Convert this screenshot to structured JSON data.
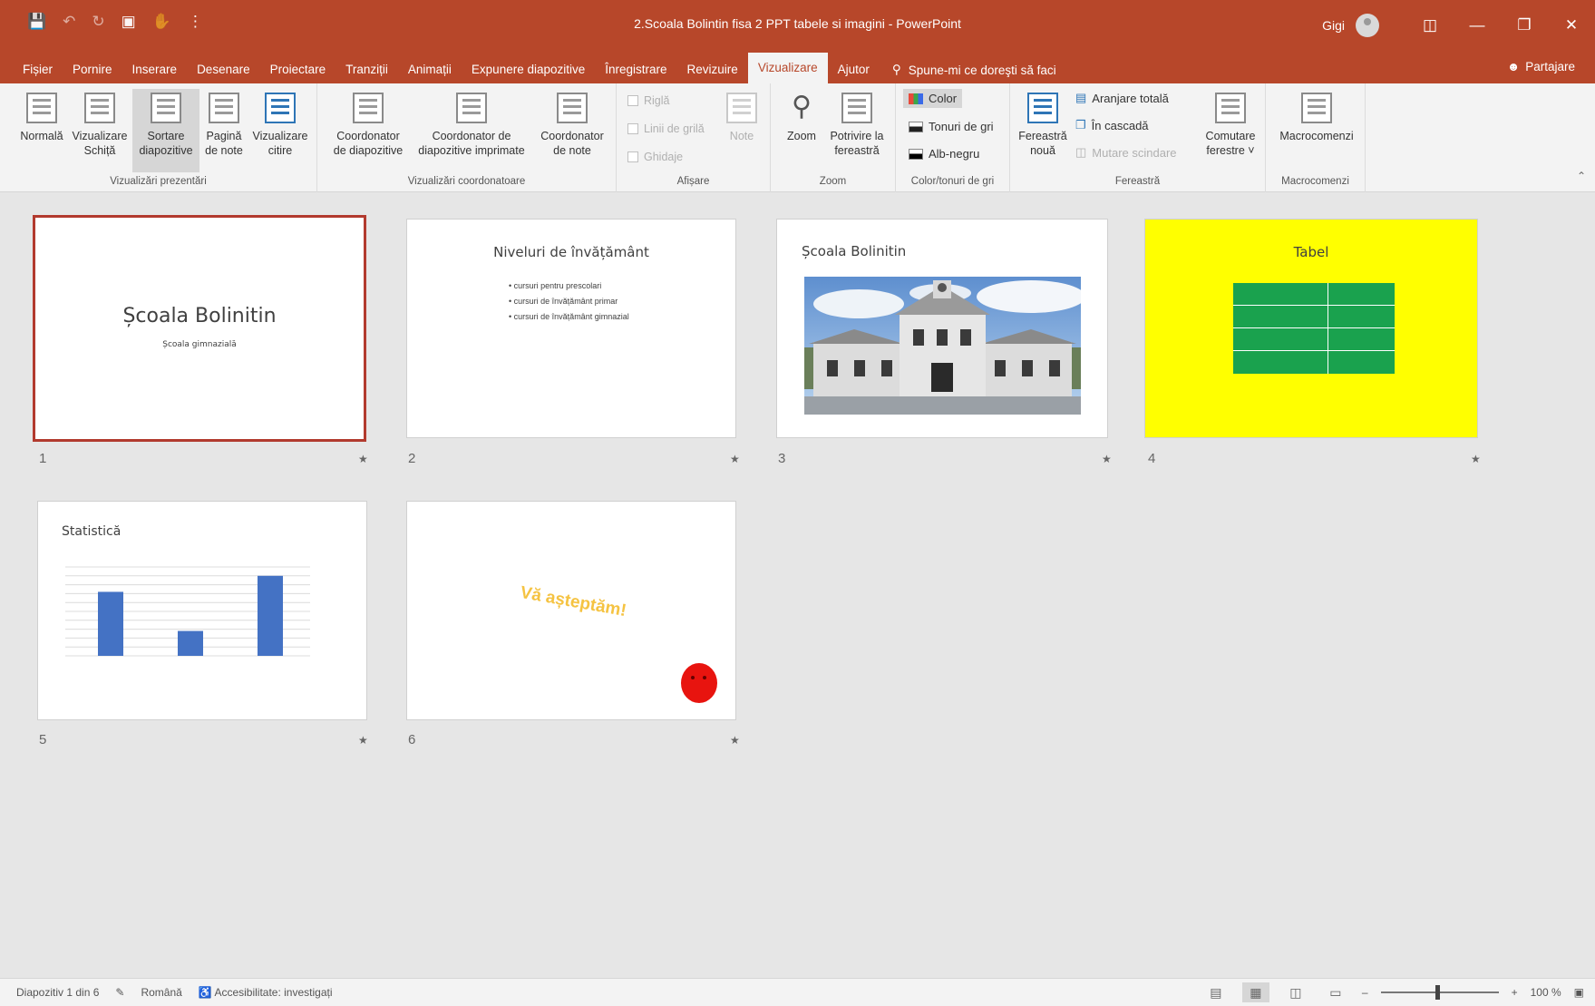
{
  "titlebar": {
    "doc_title": "2.Scoala Bolintin fisa 2 PPT tabele si imagini  -  PowerPoint",
    "user": "Gigi"
  },
  "tabs": [
    "Fișier",
    "Pornire",
    "Inserare",
    "Desenare",
    "Proiectare",
    "Tranziții",
    "Animații",
    "Expunere diapozitive",
    "Înregistrare",
    "Revizuire",
    "Vizualizare",
    "Ajutor"
  ],
  "active_tab": "Vizualizare",
  "tellme": "Spune-mi ce doreşti să faci",
  "share": "Partajare",
  "ribbon": {
    "g1": {
      "label": "Vizualizări prezentări",
      "normal": [
        "Normală",
        ""
      ],
      "outline": [
        "Vizualizare",
        "Schiță"
      ],
      "sorter": [
        "Sortare",
        "diapozitive"
      ],
      "notes": [
        "Pagină",
        "de note"
      ],
      "reading": [
        "Vizualizare",
        "citire"
      ]
    },
    "g2": {
      "label": "Vizualizări coordonatoare",
      "slide_master": [
        "Coordonator",
        "de diapozitive"
      ],
      "handout_master": [
        "Coordonator de",
        "diapozitive imprimate"
      ],
      "notes_master": [
        "Coordonator",
        "de note"
      ]
    },
    "g3": {
      "label": "Afișare",
      "ruler": "Riglă",
      "gridlines": "Linii de grilă",
      "guides": "Ghidaje",
      "notes": "Note"
    },
    "g4": {
      "label": "Zoom",
      "zoom": "Zoom",
      "fit": [
        "Potrivire la",
        "fereastră"
      ]
    },
    "g5": {
      "label": "Color/tonuri de gri",
      "color": "Color",
      "grayscale": "Tonuri de gri",
      "bw": "Alb-negru"
    },
    "g6": {
      "label": "Fereastră",
      "new_window": [
        "Fereastră",
        "nouă"
      ],
      "arrange_all": "Aranjare totală",
      "cascade": "În cascadă",
      "move_split": "Mutare scindare",
      "switch": [
        "Comutare",
        "ferestre"
      ]
    },
    "g7": {
      "label": "Macrocomenzi",
      "macros": "Macrocomenzi"
    }
  },
  "slides": {
    "s1": {
      "num": "1",
      "title": "Școala Bolinitin",
      "subtitle": "Școala gimnazială"
    },
    "s2": {
      "num": "2",
      "title": "Niveluri de învățământ",
      "bullets": [
        "cursuri pentru prescolari",
        "cursuri de învățământ primar",
        "cursuri de învățământ gimnazial"
      ]
    },
    "s3": {
      "num": "3",
      "title": "Școala Bolinitin"
    },
    "s4": {
      "num": "4",
      "title": "Tabel"
    },
    "s5": {
      "num": "5",
      "title": "Statistică"
    },
    "s6": {
      "num": "6",
      "text": "Vă așteptăm!"
    }
  },
  "chart_data": {
    "type": "bar",
    "categories": [
      "",
      "",
      ""
    ],
    "values": [
      7.2,
      2.8,
      9.0
    ],
    "ylim": [
      0,
      10
    ],
    "color": "#4472c4"
  },
  "colors": {
    "accent": "#b7472a",
    "selected_border": "#b23a2e",
    "slide4_bg": "#ffff00",
    "table_green": "#1aa24e",
    "smiley": "#e8140f",
    "welcome_text": "#f5c342"
  },
  "statusbar": {
    "slide_info": "Diapozitiv 1 din 6",
    "language": "Română",
    "accessibility": "Accesibilitate: investigați",
    "zoom": "100 %"
  }
}
